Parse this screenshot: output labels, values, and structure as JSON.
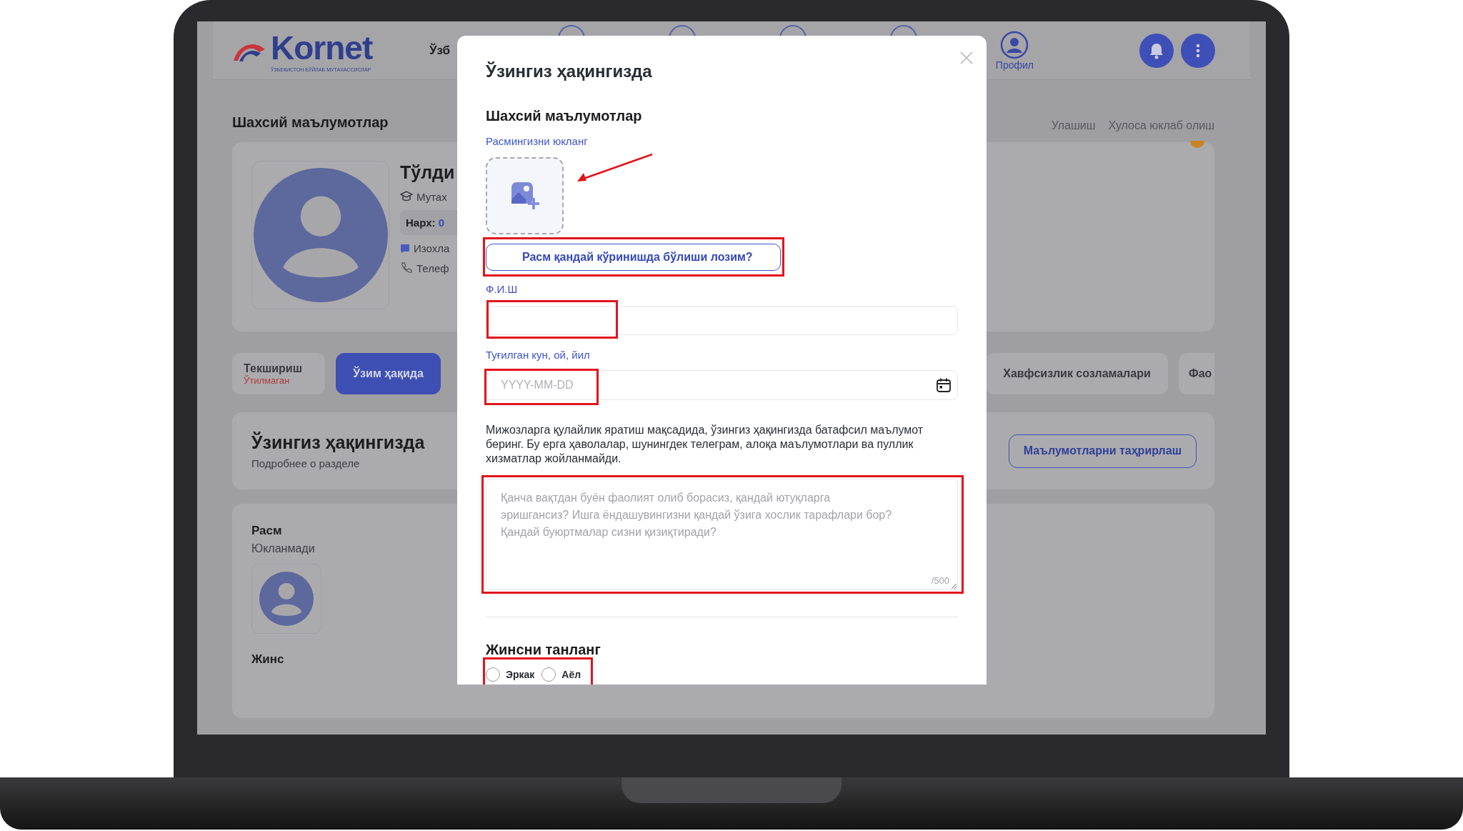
{
  "header": {
    "logo_text": "Kornet",
    "logo_tagline": "ЎЗБЕКИСТОН БЎЙЛАБ МУТАХАССИСЛАР",
    "language": "Ўзб",
    "profile_label": "Профил"
  },
  "page": {
    "title": "Шахсий маълумотлар",
    "actions": [
      "Улашиш",
      "Хулоса юклаб олиш"
    ],
    "profile": {
      "name": "Тўлди",
      "specialty": "Мутах",
      "price_label": "Нарх:",
      "price_value": "0",
      "reviews": "Изохла",
      "phone": "Телеф"
    },
    "tabs": [
      {
        "label": "Текшириш",
        "status": "Ўтилмаган",
        "selected": false
      },
      {
        "label": "Ўзим ҳақида",
        "selected": true
      },
      {
        "label": "Хавфсизлик созламалари",
        "selected": false
      },
      {
        "label": "Фао",
        "selected": false
      }
    ],
    "section": {
      "title": "Ўзингиз ҳақингизда",
      "subtitle": "Подробнее о разделе",
      "edit_button": "Маълумотларни таҳрирлаш"
    },
    "photo": {
      "title": "Расм",
      "status": "Юкланмади"
    },
    "gender_title": "Жинс"
  },
  "modal": {
    "title": "Ўзингиз ҳақингизда",
    "section_title": "Шахсий маълумотлар",
    "upload_label": "Расмингизни юкланг",
    "photo_help_button": "Расм қандай кўринишда бўлиши лозим?",
    "name_label": "Ф.И.Ш",
    "birth_label": "Туғилган кун, ой, йил",
    "birth_placeholder": "YYYY-MM-DD",
    "about_hint": "Мижозларга қулайлик яратиш мақсадида, ўзингиз ҳақингизда батафсил маълумот беринг. Бу ерга ҳаволалар, шунингдек телеграм, алоқа маълумотлари ва пуллик хизматлар жойланмайди.",
    "about_placeholder": "Қанча вақтдан буён фаолият олиб борасиз, қандай ютуқларга эришгансиз? Ишга ёндашувингизни қандай ўзига хослик тарафлари бор? Қандай буюртмалар сизни қизиқтиради?",
    "about_counter": "/500",
    "gender_title": "Жинсни танланг",
    "gender_options": [
      {
        "label": "Эркак",
        "selected": false
      },
      {
        "label": "Аёл",
        "selected": false
      }
    ]
  }
}
